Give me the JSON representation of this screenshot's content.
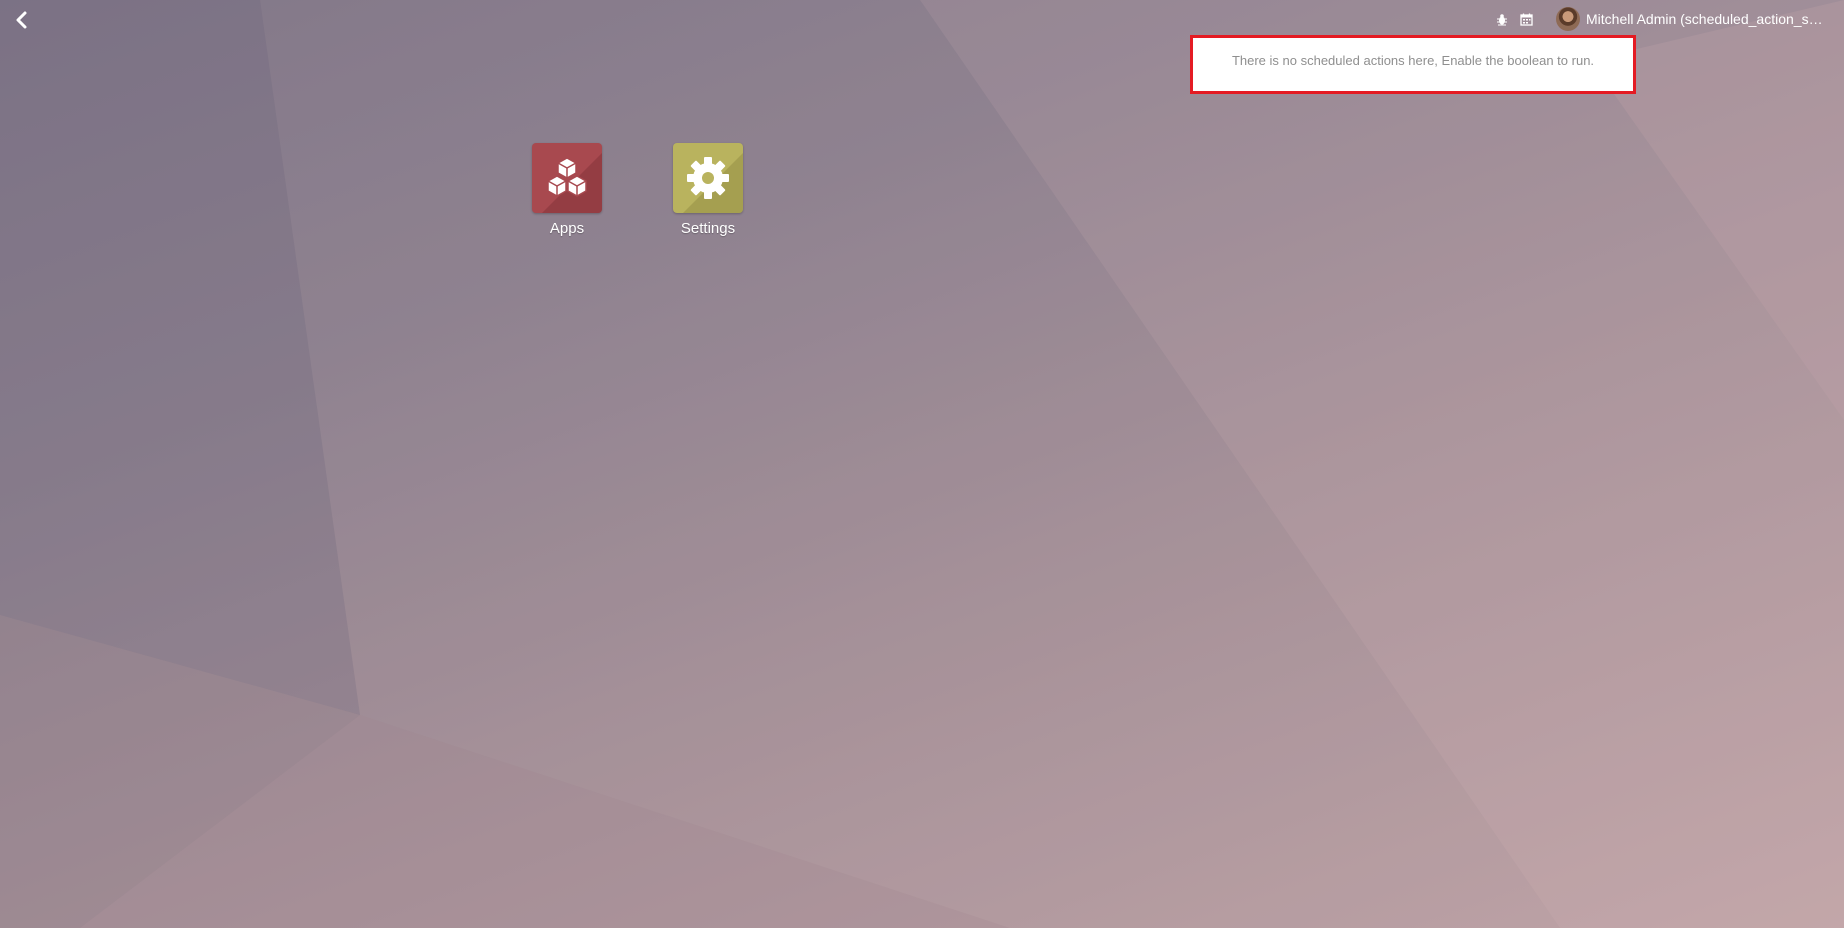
{
  "topbar": {
    "back_icon": "chevron-left-icon",
    "debug_icon": "bug-icon",
    "calendar_icon": "calendar-icon",
    "user_name": "Mitchell Admin (scheduled_action_shor…"
  },
  "notice": {
    "text": "There is no scheduled actions here, Enable the boolean to run.",
    "border_color": "#e41b23"
  },
  "apps": [
    {
      "label": "Apps",
      "icon": "cubes-icon",
      "color": "#a8494f"
    },
    {
      "label": "Settings",
      "icon": "gear-icon",
      "color": "#b9b35e"
    }
  ]
}
